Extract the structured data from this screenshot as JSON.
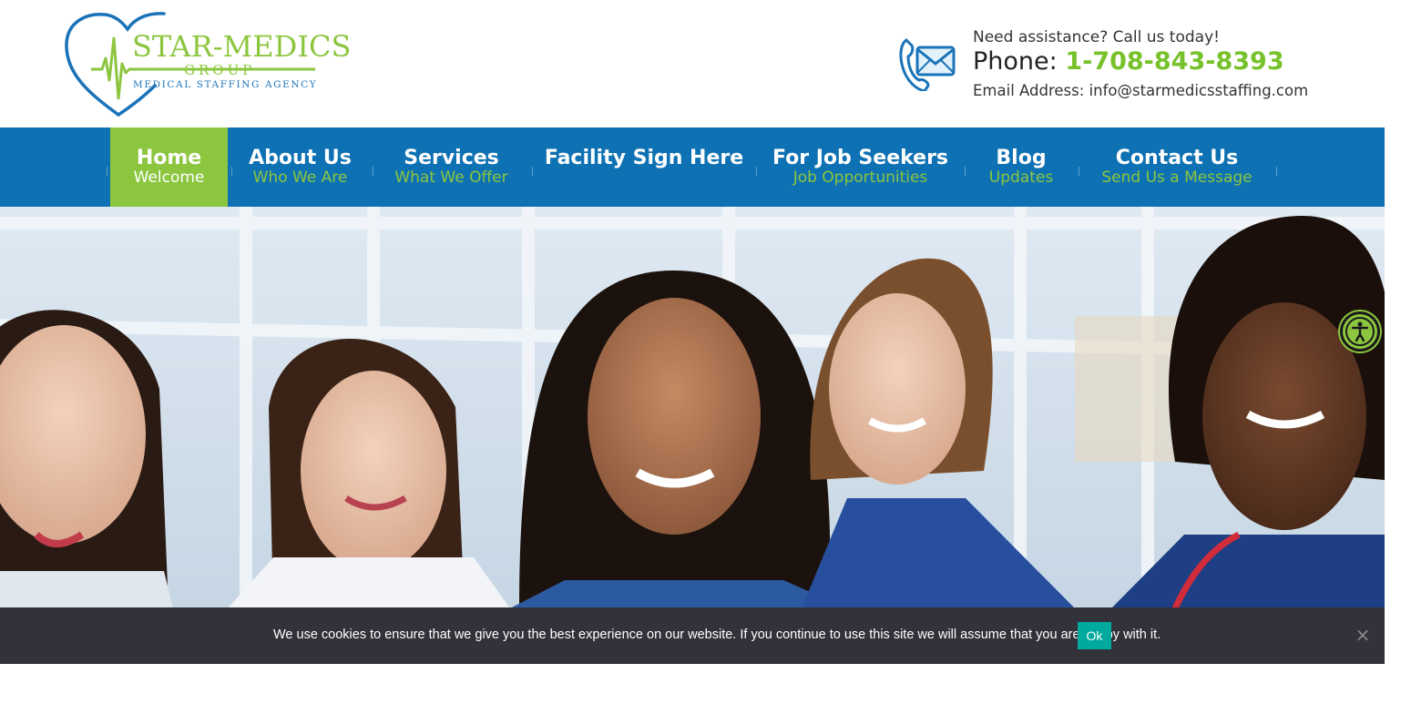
{
  "brand": {
    "name": "STAR-MEDICS",
    "group": "GROUP",
    "tagline": "MEDICAL STAFFING AGENCY",
    "green": "#8cc63f",
    "blue": "#0d71b3"
  },
  "contact": {
    "assist": "Need assistance? Call us today!",
    "phone_label": "Phone: ",
    "phone": "1-708-843-8393",
    "email_line": "Email Address: info@starmedicsstaffing.com",
    "icon": "phone-mail-icon"
  },
  "nav": {
    "items": [
      {
        "title": "Home",
        "sub": "Welcome",
        "active": true
      },
      {
        "title": "About Us",
        "sub": "Who We Are"
      },
      {
        "title": "Services",
        "sub": "What We Offer"
      },
      {
        "title": "Facility Sign Here",
        "sub": ""
      },
      {
        "title": "For Job Seekers",
        "sub": "Job Opportunities"
      },
      {
        "title": "Blog",
        "sub": "Updates"
      },
      {
        "title": "Contact Us",
        "sub": "Send Us a Message"
      }
    ]
  },
  "hero": {
    "image": "photo of five smiling medical professionals"
  },
  "accessibility": {
    "icon": "accessibility-icon"
  },
  "cookie": {
    "text": "We use cookies to ensure that we give you the best experience on our website. If you continue to use this site we will assume that you are happy with it.",
    "ok": "Ok",
    "close": "×"
  }
}
